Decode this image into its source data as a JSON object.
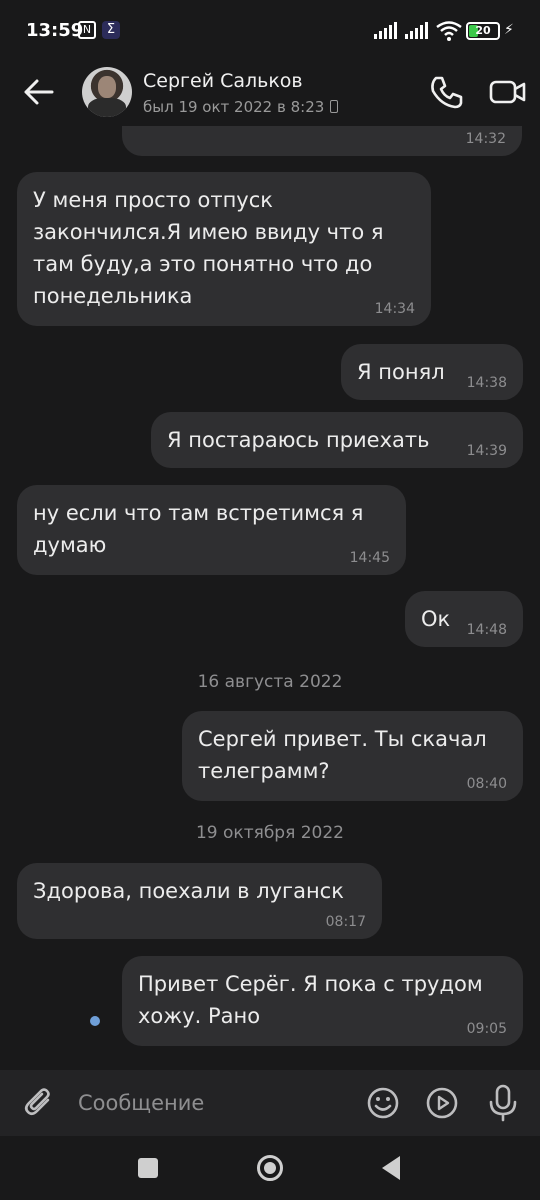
{
  "status_bar": {
    "time": "13:59",
    "nfc_glyph": "N",
    "app_glyph": "Σ",
    "battery_level": "20"
  },
  "header": {
    "contact_name": "Сергей Сальков",
    "contact_status": "был 19 окт 2022 в 8:23",
    "icons": [
      "back-arrow-icon",
      "phone-icon",
      "video-camera-icon"
    ]
  },
  "messages": [
    {
      "direction": "out",
      "text": "",
      "time": "14:32"
    },
    {
      "direction": "in",
      "text": "У меня просто отпуск закончился.Я имею ввиду что я там буду,а это понятно что до понедельника",
      "time": "14:34"
    },
    {
      "direction": "out",
      "text": "Я понял",
      "time": "14:38"
    },
    {
      "direction": "out",
      "text": "Я постараюсь приехать",
      "time": "14:39"
    },
    {
      "direction": "in",
      "text": "ну если что там встретимся я думаю",
      "time": "14:45"
    },
    {
      "direction": "out",
      "text": "Ок",
      "time": "14:48"
    },
    {
      "direction": "out",
      "text": "Сергей привет. Ты скачал телеграмм?",
      "time": "08:40"
    },
    {
      "direction": "in",
      "text": "Здорова, поехали в луганск",
      "time": "08:17"
    },
    {
      "direction": "out",
      "text": "Привет Серёг. Я пока с трудом хожу. Рано",
      "time": "09:05",
      "unread": true
    }
  ],
  "date_separators": [
    "16 августа 2022",
    "19 октября 2022"
  ],
  "composer": {
    "placeholder": "Сообщение",
    "icons": [
      "paperclip-icon",
      "emoji-icon",
      "play-circle-icon",
      "microphone-icon"
    ]
  },
  "colors": {
    "background": "#19191a",
    "bubble": "#2f2f31",
    "composer": "#232325",
    "unread_dot": "#6f9fd8",
    "battery": "#3cc84a"
  }
}
